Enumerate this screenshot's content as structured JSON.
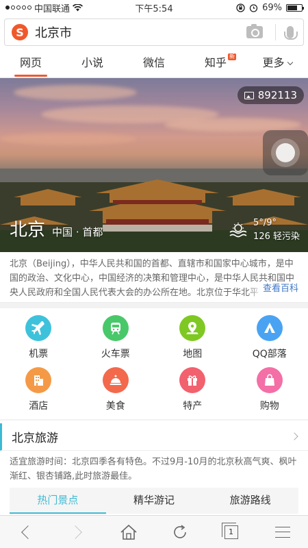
{
  "status": {
    "carrier": "中国联通",
    "time": "下午5:54",
    "battery": "69%",
    "battery_level": 0.69
  },
  "search": {
    "query": "北京市"
  },
  "tabs": [
    {
      "label": "网页",
      "active": true
    },
    {
      "label": "小说"
    },
    {
      "label": "微信"
    },
    {
      "label": "知乎",
      "badge": "新"
    },
    {
      "label": "更多"
    }
  ],
  "hero": {
    "photo_count": "892113",
    "city": "北京",
    "country": "中国",
    "dot": "·",
    "capital": "首都",
    "temp": "5°/9°",
    "aqi": "126 轻污染"
  },
  "intro": {
    "text": "北京（Beijing），中华人民共和国的首都、直辖市和国家中心城市，是中国的政治、文化中心，中国经济的决策和管理中心，是中华人民共和国中央人民政府和全国人民代表大会的办公所在地。北京位于华北平",
    "more": "查看百科"
  },
  "grid": [
    {
      "label": "机票",
      "icon": "plane-icon",
      "color": "#3ec2dc"
    },
    {
      "label": "火车票",
      "icon": "train-icon",
      "color": "#49c86a"
    },
    {
      "label": "地图",
      "icon": "map-pin-icon",
      "color": "#7fc823"
    },
    {
      "label": "QQ部落",
      "icon": "tent-icon",
      "color": "#4aa3f2"
    },
    {
      "label": "酒店",
      "icon": "hotel-icon",
      "color": "#f49a46"
    },
    {
      "label": "美食",
      "icon": "dish-icon",
      "color": "#f3694c"
    },
    {
      "label": "特产",
      "icon": "gift-icon",
      "color": "#f2616e"
    },
    {
      "label": "购物",
      "icon": "shopping-bag-icon",
      "color": "#f36fa6"
    }
  ],
  "travel": {
    "title": "北京旅游",
    "desc": "适宜旅游时间：北京四季各有特色。不过9月-10月的北京秋高气爽、枫叶渐红、银杏铺路,此时旅游最佳。",
    "tabs": [
      {
        "label": "热门景点",
        "active": true
      },
      {
        "label": "精华游记"
      },
      {
        "label": "旅游路线"
      }
    ]
  },
  "bottomnav": {
    "tab_count": "1"
  }
}
